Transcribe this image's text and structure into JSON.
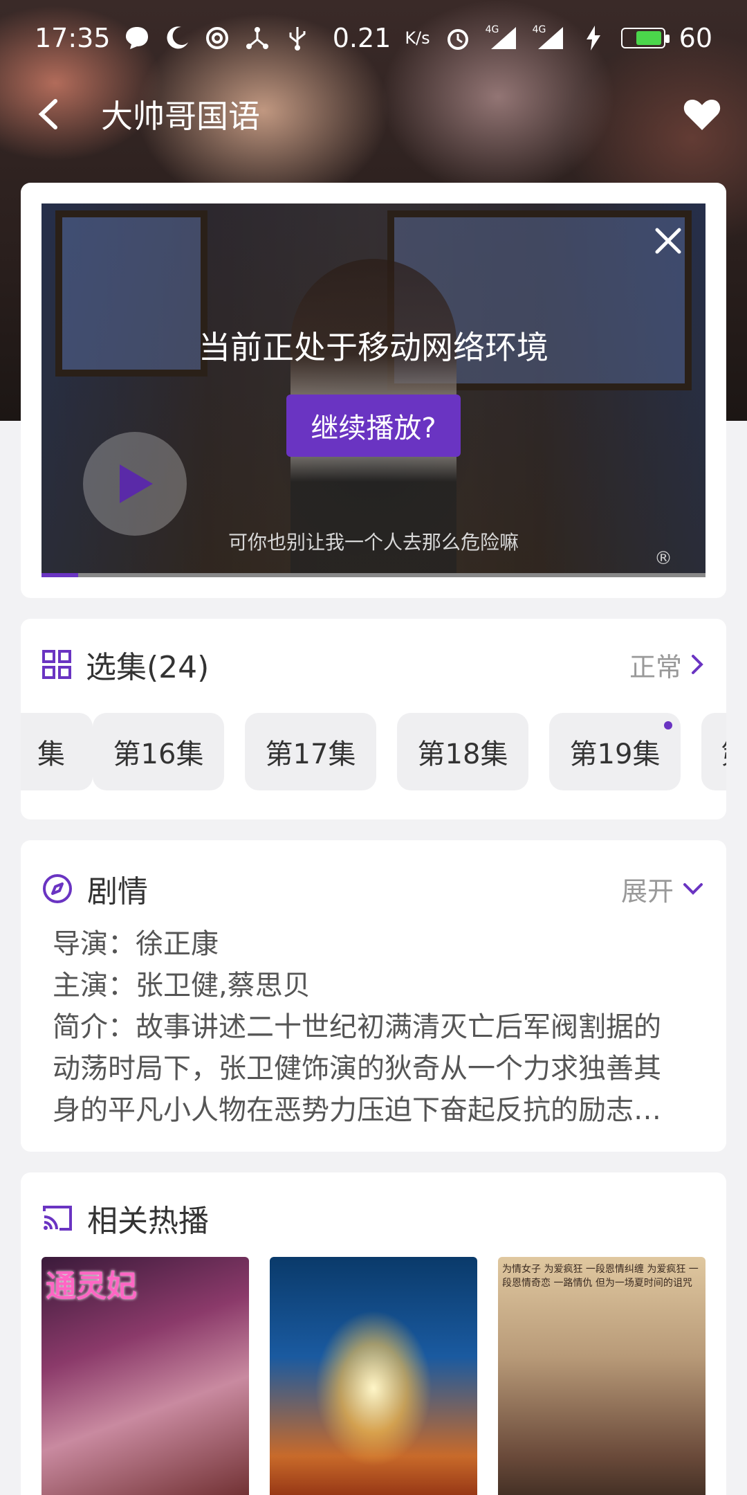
{
  "status_bar": {
    "time": "17:35",
    "net_speed": "0.21",
    "net_unit": "K/s",
    "signal1": "4G",
    "signal2": "4G",
    "battery": "60"
  },
  "header": {
    "title": "大帅哥国语"
  },
  "player": {
    "network_message": "当前正处于移动网络环境",
    "continue_label": "继续播放?",
    "subtitle": "可你也别让我一个人去那么危险嘛",
    "registered_mark": "®",
    "progress": 0.055
  },
  "episodes": {
    "title": "选集(24)",
    "mode_label": "正常",
    "items": [
      {
        "label": "集"
      },
      {
        "label": "第16集"
      },
      {
        "label": "第17集"
      },
      {
        "label": "第18集"
      },
      {
        "label": "第19集"
      },
      {
        "label": "第"
      }
    ]
  },
  "plot": {
    "title": "剧情",
    "expand_label": "展开",
    "director": "导演：徐正康",
    "cast": "主演：张卫健,蔡思贝",
    "summary_lines": [
      "简介：故事讲述二十世纪初满清灭亡后军阀割据的",
      "动荡时局下，张卫健饰演的狄奇从一个力求独善其",
      "身的平凡小人物在恶势力压迫下奋起反抗的励志…"
    ]
  },
  "related": {
    "title": "相关热播",
    "posters": [
      {
        "caption": "通灵妃"
      },
      {
        "caption": ""
      },
      {
        "caption": "为情女子 为爱疯狂 一段恩情纠缠 为爱疯狂 一段恩情奇恋 一路情仇 但为一场夏时间的诅咒"
      }
    ]
  },
  "colors": {
    "accent": "#6a34c2",
    "card_bg": "#ffffff",
    "page_bg": "#f2f2f4"
  }
}
